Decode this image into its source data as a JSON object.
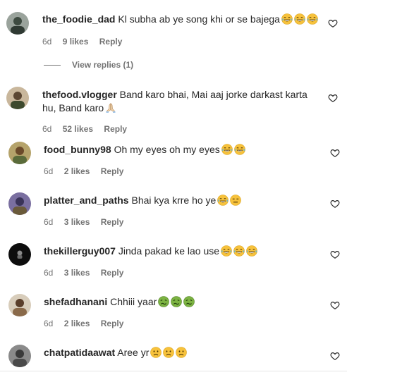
{
  "comments": [
    {
      "username": "the_foodie_dad",
      "text": "Kl subha ab ye song khi or se bajega",
      "emojis": [
        "joy",
        "joy",
        "joy"
      ],
      "age": "6d",
      "likes": "9 likes",
      "reply": "Reply",
      "view_replies": "View replies (1)",
      "avatar_color": "#5a6a5e"
    },
    {
      "username": "thefood.vlogger",
      "text": "Band karo bhai, Mai aaj jorke darkast karta hu, Band karo",
      "emojis": [
        "pray"
      ],
      "age": "6d",
      "likes": "52 likes",
      "reply": "Reply",
      "avatar_color": "#6b5a48"
    },
    {
      "username": "food_bunny98",
      "text": "Oh my eyes oh my eyes",
      "emojis": [
        "joy",
        "joy"
      ],
      "age": "6d",
      "likes": "2 likes",
      "reply": "Reply",
      "avatar_color": "#7a6a3a"
    },
    {
      "username": "platter_and_paths",
      "text": "Bhai kya krre ho ye",
      "emojis": [
        "joy",
        "expressionless"
      ],
      "age": "6d",
      "likes": "3 likes",
      "reply": "Reply",
      "avatar_color": "#4a4a6a"
    },
    {
      "username": "thekillerguy007",
      "text": "Jinda pakad ke lao use",
      "emojis": [
        "joy",
        "joy",
        "joy"
      ],
      "age": "6d",
      "likes": "3 likes",
      "reply": "Reply",
      "avatar_color": "#111111"
    },
    {
      "username": "shefadhanani",
      "text": "Chhiii yaar",
      "emojis": [
        "nauseated",
        "nauseated",
        "nauseated"
      ],
      "age": "6d",
      "likes": "2 likes",
      "reply": "Reply",
      "avatar_color": "#8a7a6a"
    },
    {
      "username": "chatpatidaawat",
      "text": "Aree yr",
      "emojis": [
        "frowning",
        "frowning",
        "frowning"
      ],
      "age": "",
      "likes": "",
      "reply": "",
      "avatar_color": "#5a5a5a"
    }
  ],
  "colors": {
    "text": "#262626",
    "muted": "#737373",
    "emoji_yellow": "#f7c23c",
    "emoji_green": "#7cb342"
  }
}
